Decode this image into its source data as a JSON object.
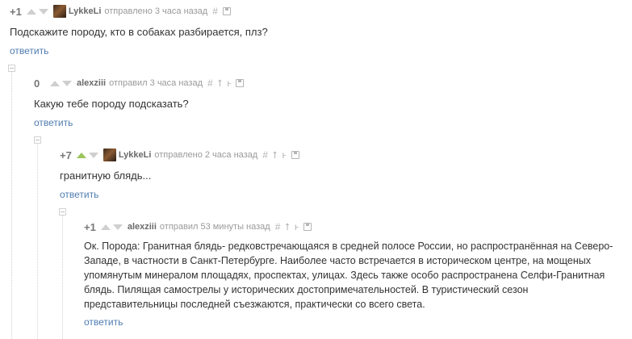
{
  "comments": [
    {
      "rating": "+1",
      "author": "LykkeLi",
      "meta": "отправлено 3 часа назад",
      "text": "Подскажите породу, кто в собаках разбирается, плз?",
      "reply": "ответить"
    },
    {
      "rating": "0",
      "author": "alexziii",
      "meta": "отправил 3 часа назад",
      "text": "Какую тебе породу подсказать?",
      "reply": "ответить"
    },
    {
      "rating": "+7",
      "author": "LykkeLi",
      "meta": "отправлено 2 часа назад",
      "text": "гранитную блядь...",
      "reply": "ответить"
    },
    {
      "rating": "+1",
      "author": "alexziii",
      "meta": "отправил 53 минуты назад",
      "text": "Ок. Порода: Гранитная блядь- редковстречающаяся в средней полосе России, но распространённая на Северо-Западе, в частности в Санкт-Петербурге. Наиболее часто встречается в историческом центре, на мощеных упомянутым минералом площадях, проспектах, улицах. Здесь также особо распространена Селфи-Гранитная блядь. Пилящая самострелы у исторических достопримечательностей. В туристический сезон представительницы последней съезжаются, практически со всего света.",
      "reply": "ответить"
    }
  ],
  "icons": {
    "link": "#",
    "parent": "⭡",
    "subtree": "ⱶ"
  },
  "colors": {
    "upvote_active": "#9bc45b",
    "reply_link": "#4f7caf"
  }
}
